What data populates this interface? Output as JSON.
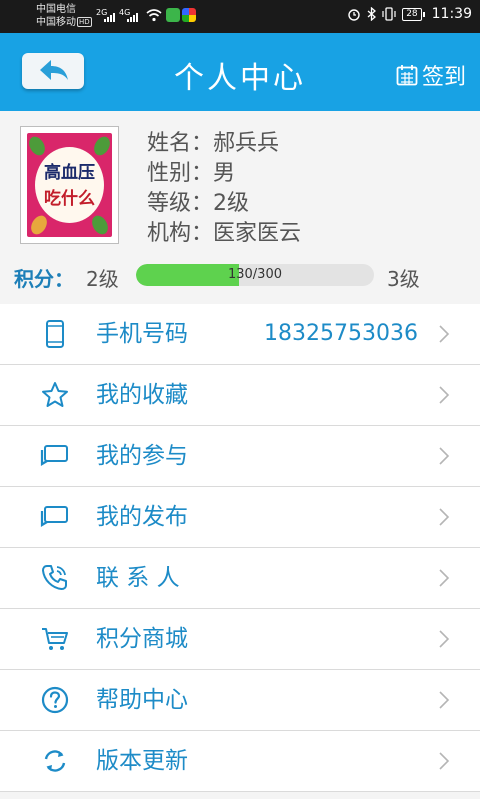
{
  "status_bar": {
    "carrier_1": "中国电信",
    "carrier_2": "中国移动",
    "hd_badge": "HD",
    "network_1": "2G",
    "network_2": "4G",
    "battery": "28",
    "time": "11:39"
  },
  "header": {
    "title": "个人中心",
    "signin_label": "签到"
  },
  "profile": {
    "book_title_1": "高血压",
    "book_title_2": "吃什么",
    "fields": [
      {
        "label": "姓名：",
        "value": "郝兵兵"
      },
      {
        "label": "性别：",
        "value": "男"
      },
      {
        "label": "等级：",
        "value": "2级"
      },
      {
        "label": "机构：",
        "value": "医家医云"
      }
    ],
    "points_label": "积分：",
    "current_level": "2级",
    "next_level": "3级",
    "progress_text": "130/300",
    "progress_fraction": 0.433
  },
  "menu": [
    {
      "icon": "phone-icon",
      "label": "手机号码",
      "value": "18325753036"
    },
    {
      "icon": "star-icon",
      "label": "我的收藏"
    },
    {
      "icon": "chat-icon",
      "label": "我的参与"
    },
    {
      "icon": "chat-icon",
      "label": "我的发布"
    },
    {
      "icon": "call-icon",
      "label": "联 系 人"
    },
    {
      "icon": "cart-icon",
      "label": "积分商城"
    },
    {
      "icon": "help-icon",
      "label": "帮助中心"
    },
    {
      "icon": "refresh-icon",
      "label": "版本更新"
    }
  ],
  "colors": {
    "header": "#18a2e4",
    "accent": "#1d8bc7",
    "progress": "#5ed24e"
  }
}
